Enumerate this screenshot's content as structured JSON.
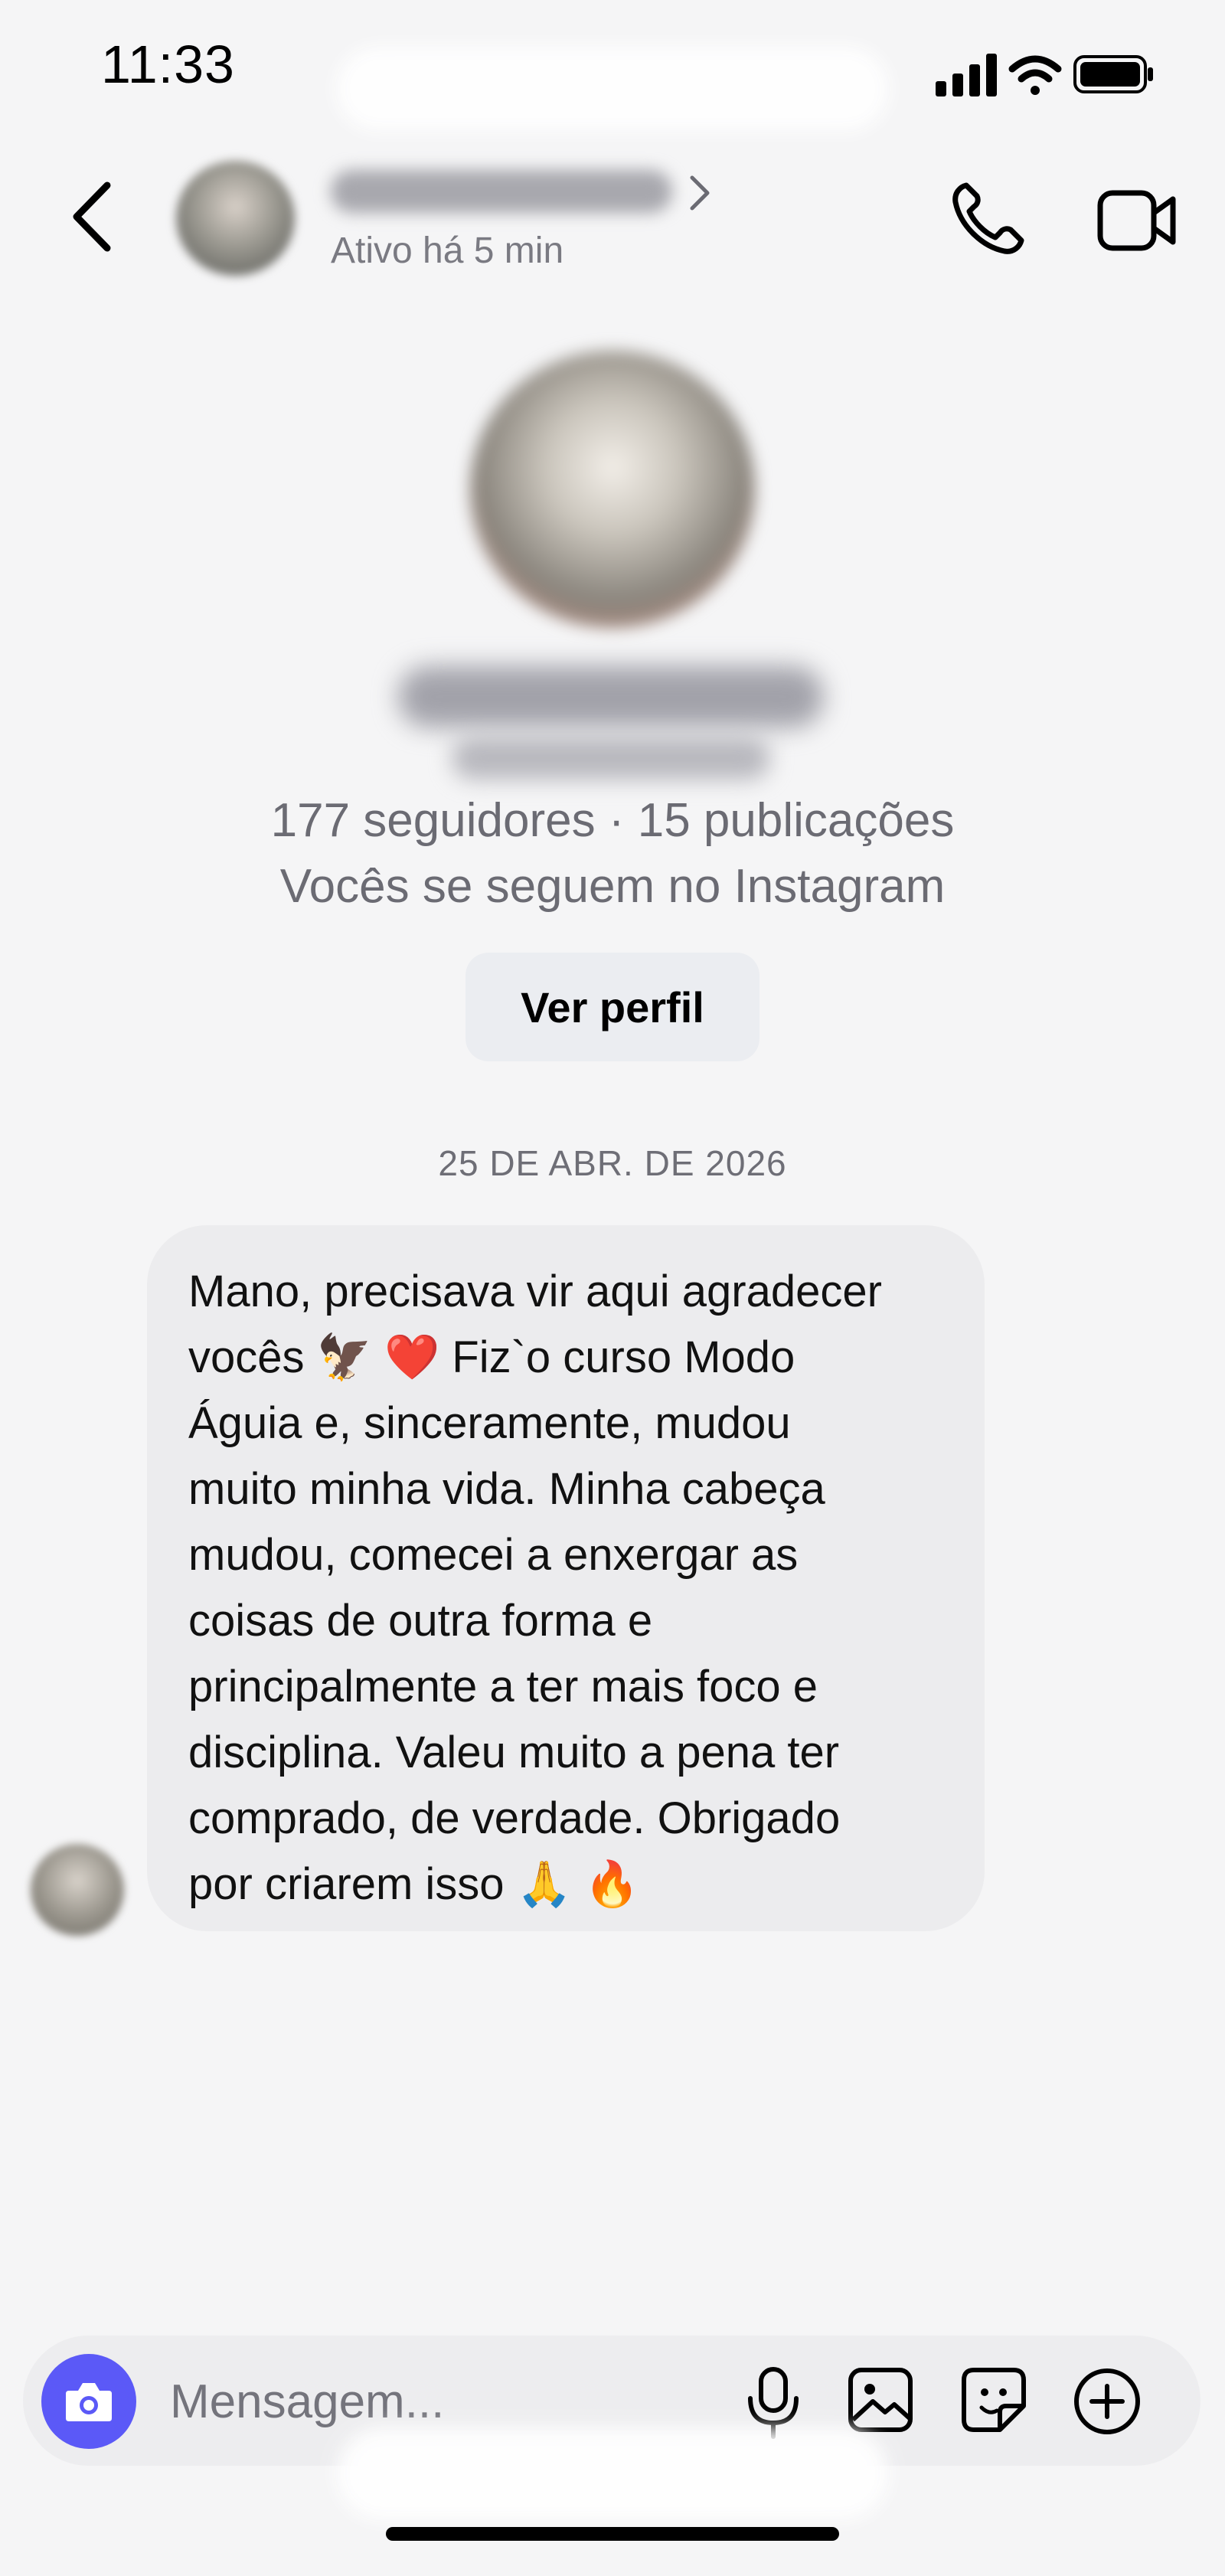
{
  "status_bar": {
    "time": "11:33",
    "icons": [
      "cellular-signal-icon",
      "wifi-icon",
      "battery-icon"
    ]
  },
  "header": {
    "back_icon": "chevron-left-icon",
    "contact_status": "Ativo há 5 min",
    "call_icon": "phone-icon",
    "video_icon": "video-camera-icon"
  },
  "profile": {
    "stats": "177 seguidores · 15 publicações",
    "mutual": "Vocês se seguem no Instagram",
    "view_profile_label": "Ver perfil"
  },
  "conversation": {
    "date_divider": "25 DE ABR. DE 2026",
    "messages": [
      {
        "direction": "incoming",
        "text": "Mano, precisava vir aqui agradecer\nvocês 🦅 ❤️  Fiz`o curso Modo\nÁguia e, sinceramente, mudou\nmuito minha vida. Minha cabeça\nmudou, comecei a enxergar as\ncoisas de outra forma e\nprincipalmente a ter mais foco e\ndisciplina. Valeu muito a pena ter\ncomprado, de verdade. Obrigado\npor criarem isso 🙏 🔥"
      }
    ]
  },
  "composer": {
    "placeholder": "Mensagem...",
    "icons": [
      "camera-icon",
      "microphone-icon",
      "image-gallery-icon",
      "sticker-icon",
      "plus-circle-icon"
    ],
    "camera_color": "#5b59f7"
  }
}
